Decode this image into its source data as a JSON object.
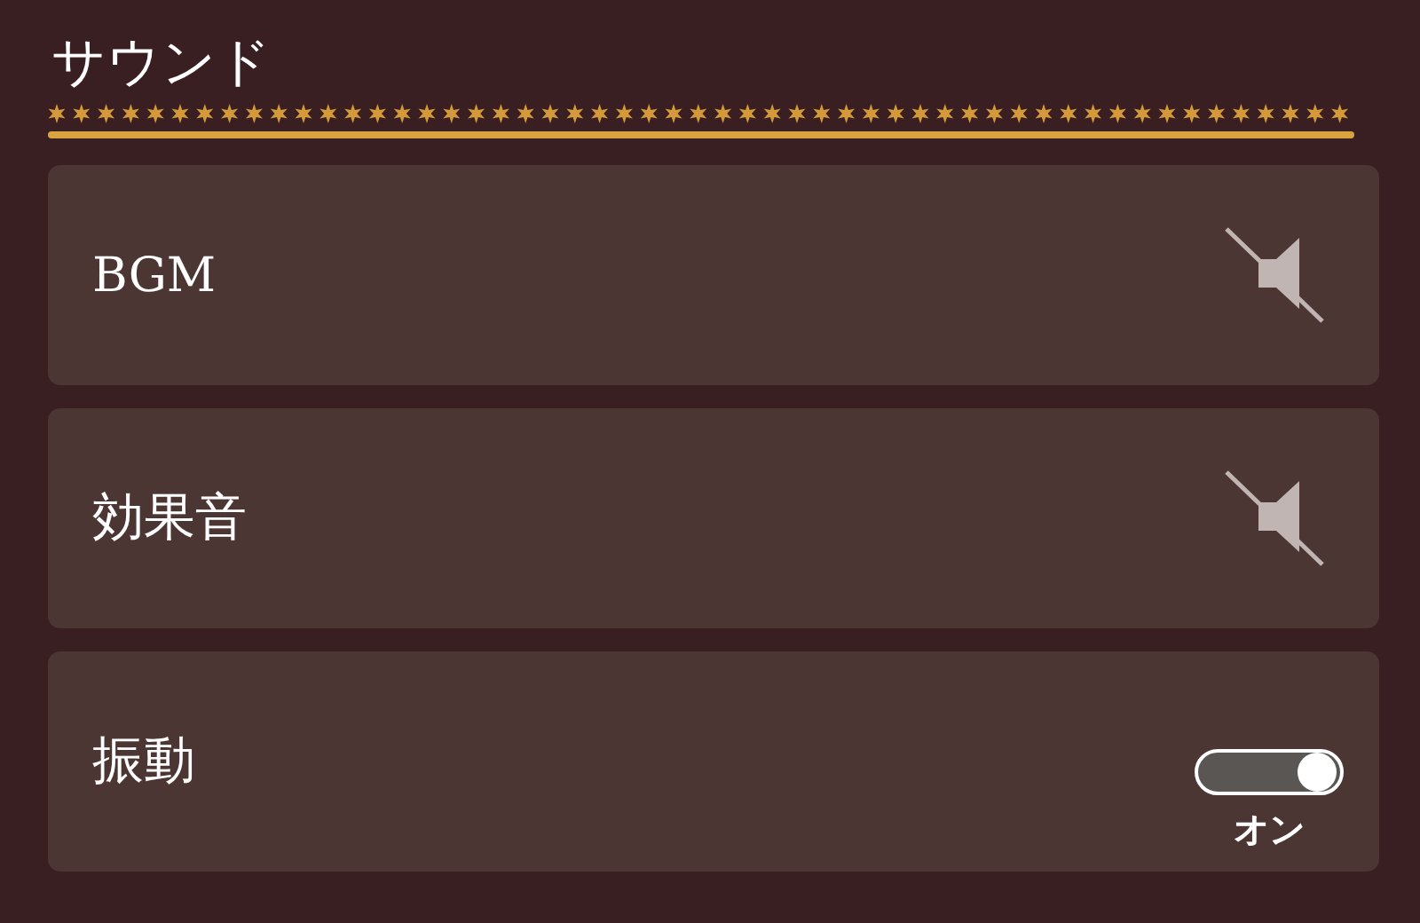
{
  "title": "サウンド",
  "settings": [
    {
      "kind": "sound",
      "label": "BGM",
      "muted": true
    },
    {
      "kind": "sound",
      "label": "効果音",
      "muted": true
    },
    {
      "kind": "toggle",
      "label": "振動",
      "on": true,
      "caption": "オン"
    }
  ]
}
